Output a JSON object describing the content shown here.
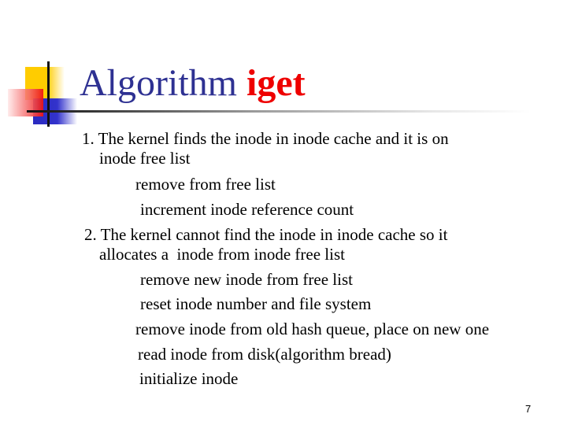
{
  "slide": {
    "title": {
      "main": "Algorithm ",
      "accent": "iget"
    },
    "colors": {
      "title": "#2e3192",
      "accent": "#ee0000",
      "text": "#000000",
      "logo_yellow": "#ffcc00",
      "logo_blue": "#3333cc",
      "logo_red": "#ee1111"
    },
    "body_lines": [
      "1. The kernel finds the inode in inode cache and it is on",
      "inode free list",
      "remove from free list",
      "increment inode reference count",
      "2. The kernel cannot find the inode in inode cache so it",
      "allocates a  inode from inode free list",
      "remove new inode from free list",
      "reset inode number and file system",
      "remove inode from old hash queue, place on new one",
      "read inode from disk(algorithm bread)",
      "initialize inode"
    ],
    "page_number": "7"
  }
}
